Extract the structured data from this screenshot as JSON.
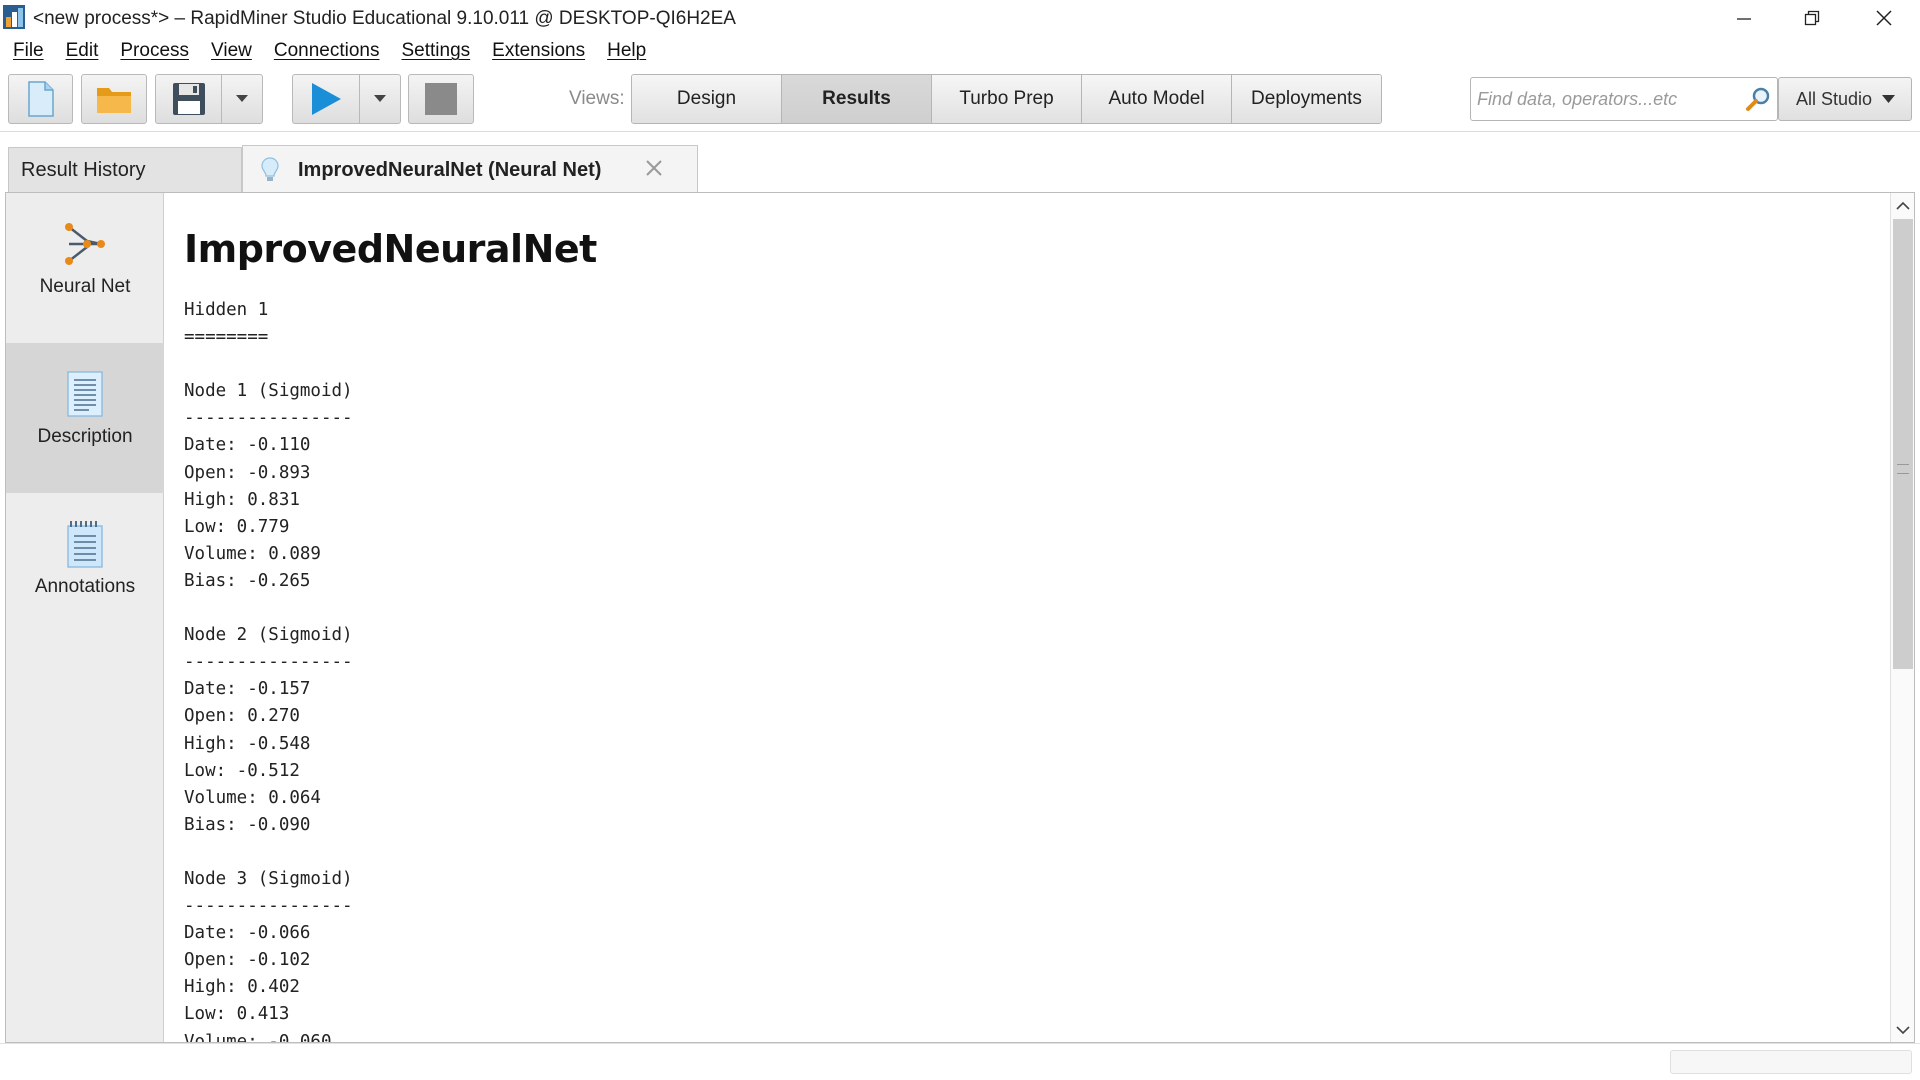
{
  "window": {
    "title": "<new process*> – RapidMiner Studio Educational 9.10.011 @ DESKTOP-QI6H2EA"
  },
  "menu": [
    "File",
    "Edit",
    "Process",
    "View",
    "Connections",
    "Settings",
    "Extensions",
    "Help"
  ],
  "toolbar": {
    "views_label": "Views:",
    "views": [
      "Design",
      "Results",
      "Turbo Prep",
      "Auto Model",
      "Deployments"
    ],
    "active_view": "Results",
    "search_placeholder": "Find data, operators...etc",
    "scope_label": "All Studio"
  },
  "tabs": {
    "history_label": "Result History",
    "result_label": "ImprovedNeuralNet (Neural Net)"
  },
  "sidebar": {
    "items": [
      {
        "label": "Neural Net",
        "icon": "neural-net-icon"
      },
      {
        "label": "Description",
        "icon": "description-icon"
      },
      {
        "label": "Annotations",
        "icon": "annotations-icon"
      }
    ],
    "active": "Description"
  },
  "content": {
    "title": "ImprovedNeuralNet",
    "description_text": "Hidden 1\n========\n\nNode 1 (Sigmoid)\n----------------\nDate: -0.110\nOpen: -0.893\nHigh: 0.831\nLow: 0.779\nVolume: 0.089\nBias: -0.265\n\nNode 2 (Sigmoid)\n----------------\nDate: -0.157\nOpen: 0.270\nHigh: -0.548\nLow: -0.512\nVolume: 0.064\nBias: -0.090\n\nNode 3 (Sigmoid)\n----------------\nDate: -0.066\nOpen: -0.102\nHigh: 0.402\nLow: 0.413\nVolume: -0.060"
  },
  "colors": {
    "accent_blue": "#1a8ed6",
    "folder_orange": "#f2a42a",
    "active_view_bg": "#d4d4d4",
    "sidebar_bg": "#ededed"
  }
}
